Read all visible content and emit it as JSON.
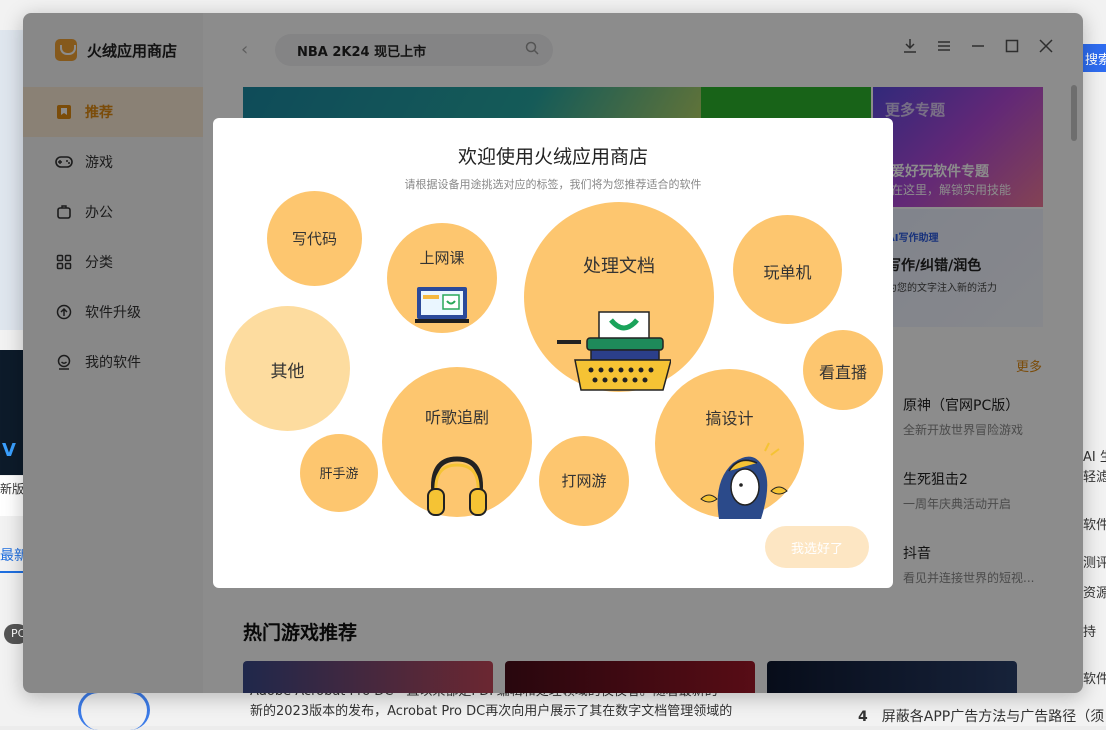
{
  "background": {
    "left_card_text": "新版、",
    "left_tab": "最新",
    "left_pill": "PC",
    "search_btn": "搜索",
    "right_snippets": [
      "AI 生",
      "轻滤",
      "软件",
      "测评",
      "资源",
      "持",
      "软件"
    ],
    "article_line1": "Adobe Acrobat Pro DC一直以来都是PDF编辑和处理领域的佼佼者。随着最新的",
    "article_line2": "新的2023版本的发布，Acrobat Pro DC再次向用户展示了其在数字文档管理领域的",
    "rank_num": "4",
    "rank_text": "屏蔽各APP广告方法与广告路径（须"
  },
  "app": {
    "name": "火绒应用商店",
    "search_text": "NBA 2K24 现已上市",
    "nav": [
      {
        "label": "推荐",
        "icon": "bookmark-icon",
        "active": true
      },
      {
        "label": "游戏",
        "icon": "gamepad-icon"
      },
      {
        "label": "办公",
        "icon": "briefcase-icon"
      },
      {
        "label": "分类",
        "icon": "grid-icon"
      },
      {
        "label": "软件升级",
        "icon": "upgrade-icon"
      },
      {
        "label": "我的软件",
        "icon": "my-software-icon"
      }
    ],
    "window_controls": [
      "download-icon",
      "menu-icon",
      "minimize-icon",
      "maximize-icon",
      "close-icon"
    ],
    "cards": {
      "more_topics": "更多专题",
      "topic_title": "爱好玩软件专题",
      "topic_sub": "在这里，解锁实用技能",
      "ai_tag": "AI写作助理",
      "ai_title": "写作/纠错/润色",
      "ai_sub": "为您的文字注入新的活力"
    },
    "more": "更多",
    "rank_list": [
      {
        "name": "原神（官网PC版）",
        "desc": "全新开放世界冒险游戏"
      },
      {
        "name": "生死狙击2",
        "desc": "一周年庆典活动开启"
      },
      {
        "name": "抖音",
        "desc": "看见并连接世界的短视..."
      }
    ],
    "hot_games_title": "热门游戏推荐"
  },
  "modal": {
    "title": "欢迎使用火绒应用商店",
    "subtitle": "请根据设备用途挑选对应的标签，我们将为您推荐适合的软件",
    "tags": {
      "code": "写代码",
      "class": "上网课",
      "docs": "处理文档",
      "single": "玩单机",
      "other": "其他",
      "music": "听歌追剧",
      "design": "搞设计",
      "live": "看直播",
      "mobile": "肝手游",
      "online": "打网游"
    },
    "done": "我选好了"
  }
}
